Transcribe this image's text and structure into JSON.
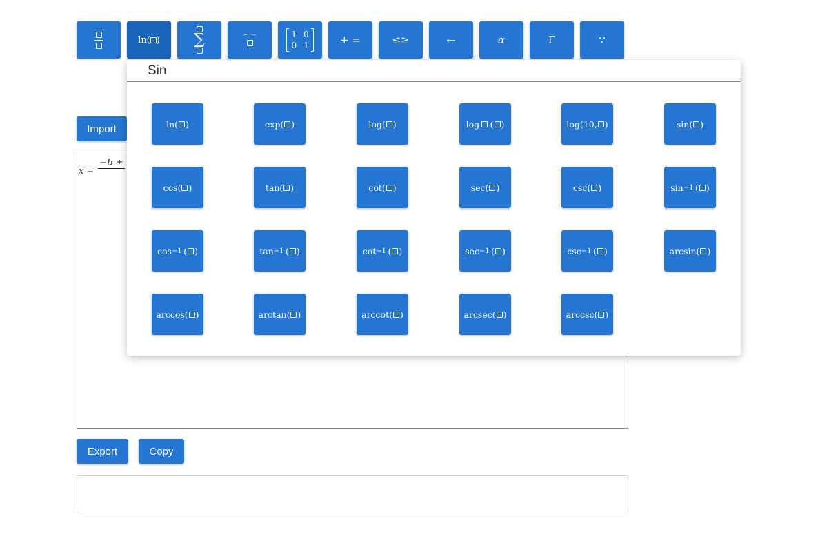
{
  "toolbar": {
    "buttons": [
      {
        "id": "fraction",
        "icon": "fraction-icon"
      },
      {
        "id": "functions",
        "label": "ln(",
        "tail": ")",
        "active": true
      },
      {
        "id": "sum",
        "label": "∑"
      },
      {
        "id": "accent",
        "icon": "arc-accent-icon"
      },
      {
        "id": "matrix",
        "cells": [
          "1",
          "0",
          "0",
          "1"
        ]
      },
      {
        "id": "operators",
        "label": "+ ="
      },
      {
        "id": "relations",
        "label": "≤≥"
      },
      {
        "id": "arrows",
        "label": "←"
      },
      {
        "id": "greek-lower",
        "label": "α"
      },
      {
        "id": "greek-upper",
        "label": "Γ"
      },
      {
        "id": "misc",
        "label": "∵"
      }
    ]
  },
  "import_label": "Import",
  "export_label": "Export",
  "copy_label": "Copy",
  "editor": {
    "formula_lhs": "x =",
    "formula_num": "−b ±"
  },
  "popup": {
    "title": "Sin",
    "functions": [
      {
        "pre": "ln(",
        "post": ")"
      },
      {
        "pre": "exp(",
        "post": ")"
      },
      {
        "pre": "log(",
        "post": ")"
      },
      {
        "pre": "log",
        "sub": true,
        "post": ")"
      },
      {
        "pre": "log(10, ",
        "post": ")"
      },
      {
        "pre": "sin(",
        "post": ")"
      },
      {
        "pre": "cos(",
        "post": ")"
      },
      {
        "pre": "tan(",
        "post": ")"
      },
      {
        "pre": "cot(",
        "post": ")"
      },
      {
        "pre": "sec(",
        "post": ")"
      },
      {
        "pre": "csc(",
        "post": ")"
      },
      {
        "pre": "sin",
        "sup": "−1",
        "post": ")"
      },
      {
        "pre": "cos",
        "sup": "−1",
        "post": ")"
      },
      {
        "pre": "tan",
        "sup": "−1",
        "post": ")"
      },
      {
        "pre": "cot",
        "sup": "−1",
        "post": ")"
      },
      {
        "pre": "sec",
        "sup": "−1",
        "post": ")"
      },
      {
        "pre": "csc",
        "sup": "−1",
        "post": ")"
      },
      {
        "pre": "arcsin(",
        "post": ")"
      },
      {
        "pre": "arccos(",
        "post": ")"
      },
      {
        "pre": "arctan(",
        "post": ")"
      },
      {
        "pre": "arccot(",
        "post": ")"
      },
      {
        "pre": "arcsec(",
        "post": ")"
      },
      {
        "pre": "arccsc(",
        "post": ")"
      }
    ]
  },
  "colors": {
    "button": "#2476d2",
    "button_active": "#1a63bb"
  }
}
